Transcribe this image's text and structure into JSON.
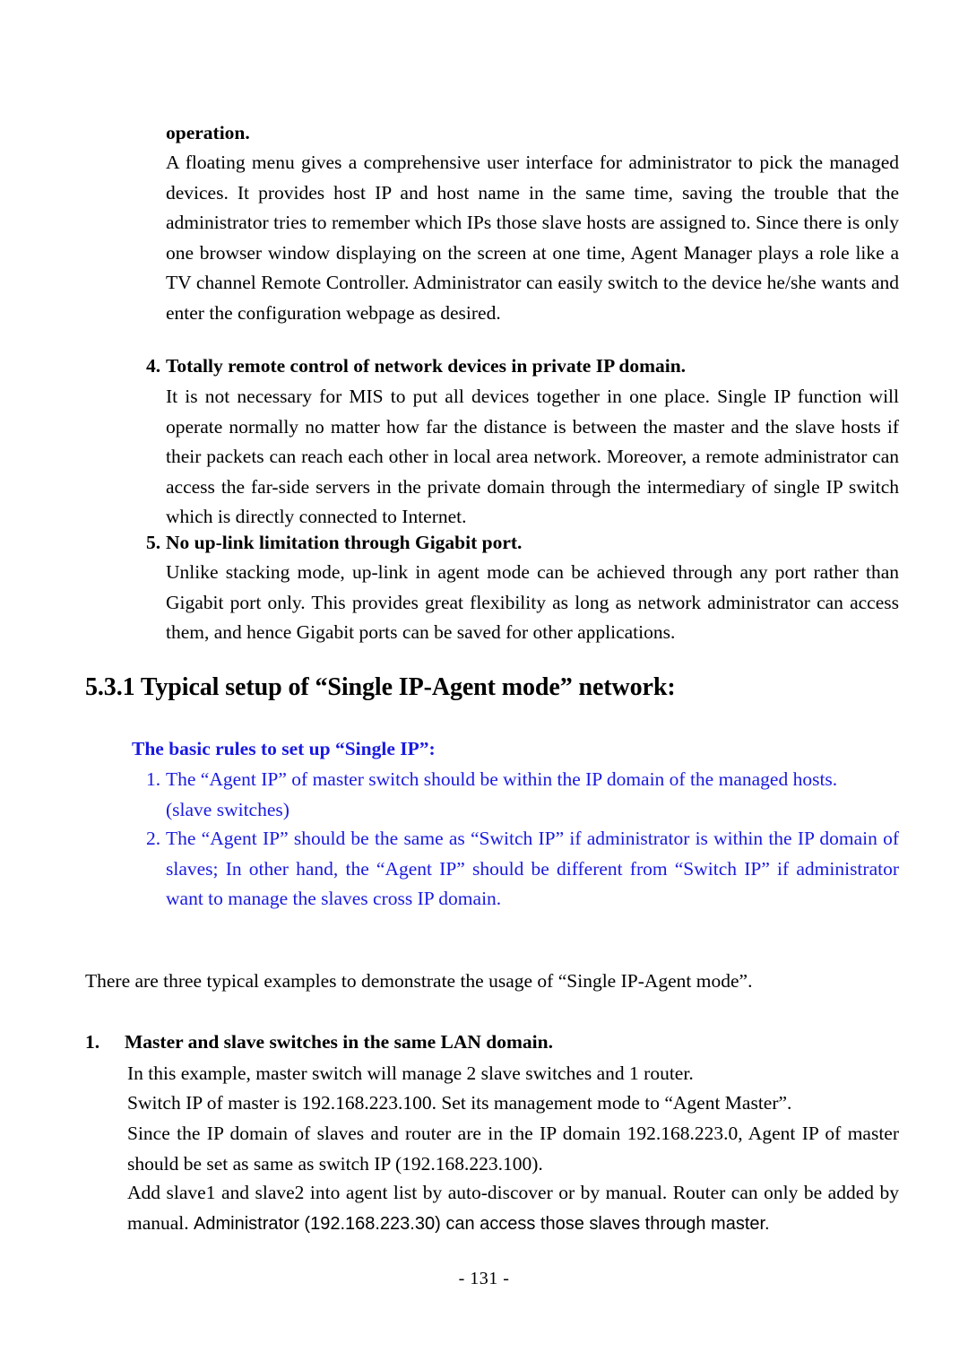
{
  "document": {
    "page_number_label": "- 131 -",
    "accent_blue": "#1a1aE0",
    "text_color": "#000000"
  },
  "blocks": {
    "operation_heading": "operation.",
    "operation_paragraph": "A floating menu gives a comprehensive user interface for administrator to pick the managed devices. It provides host IP and host name in the same time, saving the trouble that the administrator tries to remember which IPs those slave hosts are assigned to. Since there is only one browser window displaying on the screen at one time, Agent Manager plays a role like a TV channel Remote Controller. Administrator can easily switch to the device he/she wants and enter the configuration webpage as desired.",
    "item4": {
      "number": "4.",
      "heading": "Totally remote control of network devices in private IP domain.",
      "paragraph": "It is not necessary for MIS to put all devices together in one place. Single IP function will operate normally no matter how far the distance is between the master and the slave hosts if their packets can reach each other in local area network. Moreover, a remote administrator can access the far-side servers in the private domain through the intermediary of single IP switch which is directly connected to Internet."
    },
    "item5": {
      "number": "5.",
      "heading": "No up-link limitation through Gigabit port.",
      "paragraph": "Unlike stacking mode, up-link in agent mode can be achieved through any port rather than Gigabit port only. This provides great flexibility as long as network administrator can access them, and hence Gigabit ports can be saved for other applications."
    },
    "section_heading": "5.3.1 Typical setup of “Single IP-Agent mode” network:",
    "basic_rules": {
      "heading": "The basic rules to set up “Single IP”:",
      "rules": [
        {
          "number": "1.",
          "text": "The “Agent IP” of master switch should be within the IP domain of the managed hosts.",
          "continuation": "(slave switches)"
        },
        {
          "number": "2.",
          "text": "The “Agent IP” should be the same as “Switch IP” if administrator is within the IP domain of slaves; In other hand, the “Agent IP” should be different from “Switch IP” if administrator want to manage the slaves cross IP domain."
        }
      ]
    },
    "examples_intro": "There are three typical examples to demonstrate the usage of “Single IP-Agent mode”.",
    "example1": {
      "number": "1.",
      "heading": "Master and slave switches in the same LAN domain.",
      "line1": "In this example, master switch will manage 2 slave switches and 1 router.",
      "line2": "Switch IP of master is 192.168.223.100. Set its management mode to “Agent Master”.",
      "line3": "Since the IP domain of slaves and router are in the IP domain 192.168.223.0, Agent IP of master should be set as same as switch IP (192.168.223.100).",
      "line4_serif_part": "Add slave1 and slave2 into agent list by auto-discover or by manual. Router can only be added by manual. ",
      "line4_sans_part": "Administrator (192.168.223.30) can access those slaves through master."
    }
  }
}
